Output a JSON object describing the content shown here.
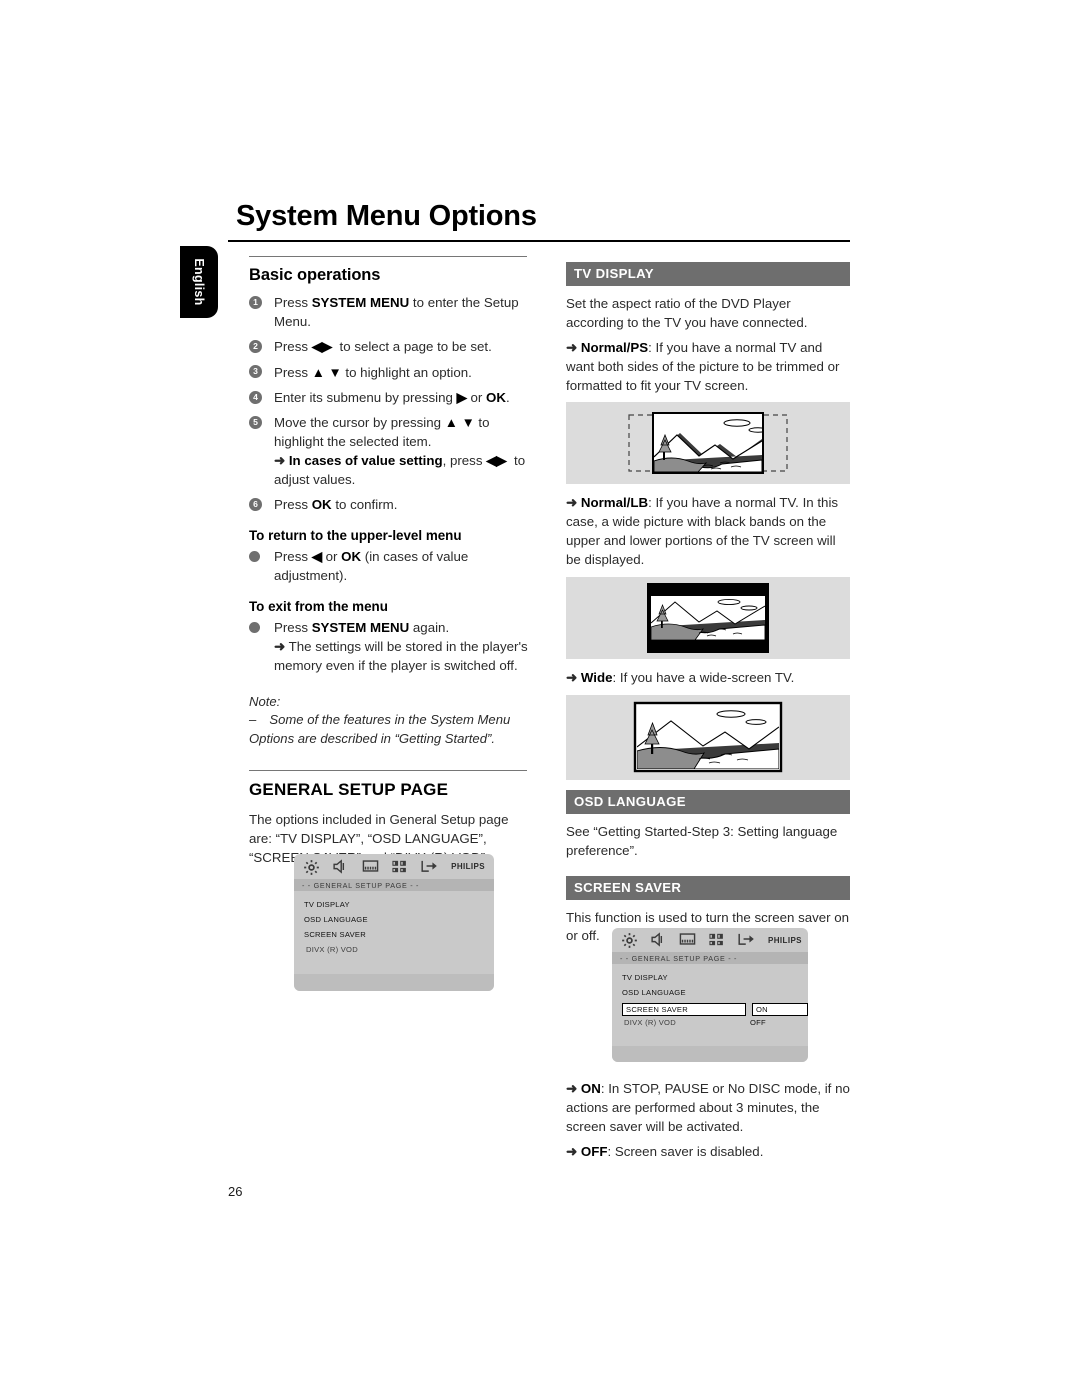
{
  "page": {
    "title": "System Menu Options",
    "language_tab": "English",
    "page_number": "26"
  },
  "left_column": {
    "basic_operations": {
      "heading": "Basic operations",
      "steps": [
        {
          "num": "1",
          "html": "Press <b>SYSTEM MENU</b> to enter the Setup Menu."
        },
        {
          "num": "2",
          "html": "Press <b>◀▶</b>&nbsp; to select a page to be set."
        },
        {
          "num": "3",
          "html": "Press <b>▲ ▼</b> to highlight an option."
        },
        {
          "num": "4",
          "html": "Enter its submenu by pressing <b>▶</b> or <b>OK</b>."
        },
        {
          "num": "5",
          "html": "Move the cursor by pressing <b>▲ ▼</b> to highlight the selected item.<br><span class=\"arrow\">➜</span> <b>In cases of value setting</b>, press <b>◀▶</b>&nbsp; to adjust values."
        },
        {
          "num": "6",
          "html": "Press <b>OK</b> to confirm."
        }
      ],
      "return_heading": "To return to the upper-level menu",
      "return_text": "Press <b>◀</b> or <b>OK</b> (in cases of value adjustment).",
      "exit_heading": "To exit from the menu",
      "exit_text": "Press <b>SYSTEM MENU</b> again.<br><span class=\"arrow\">➜</span> The settings will be stored in the player's memory even if the player is switched off.",
      "note_label": "Note:",
      "note_text": "– Some of the features in the System Menu Options are described in “Getting Started”."
    },
    "general_setup": {
      "heading": "GENERAL SETUP PAGE",
      "intro": "The options included in General Setup page are: “TV DISPLAY”, “OSD LANGUAGE”, “SCREEN SAVER” and  “DIVX (R) VOD”."
    },
    "osd_mockup": {
      "brand": "PHILIPS",
      "title": "- -  GENERAL  SETUP  PAGE  - -",
      "items": [
        "TV DISPLAY",
        "OSD LANGUAGE",
        "SCREEN SAVER",
        "DIVX (R) VOD"
      ],
      "icons": [
        "gear-icon",
        "speaker-icon",
        "video-icon",
        "preference-icon",
        "exit-icon"
      ]
    }
  },
  "right_column": {
    "tv_display": {
      "bar": "TV DISPLAY",
      "intro": "Set the aspect ratio of the DVD Player according to the TV you have connected.",
      "normal_ps": "<span class=\"arrow\">➜</span> <b>Normal/PS</b>: If you have a normal TV and want both sides of the picture to be trimmed or formatted to fit your TV screen.",
      "normal_lb": "<span class=\"arrow\">➜</span> <b>Normal/LB</b>: If you have a normal TV. In this case, a wide picture with black bands on the upper and lower portions of the TV screen will be displayed.",
      "wide": "<span class=\"arrow\">➜</span> <b>Wide</b>: If you have a wide-screen TV."
    },
    "osd_language": {
      "bar": "OSD LANGUAGE",
      "text": "See “Getting Started-Step 3: Setting language preference”."
    },
    "screen_saver": {
      "bar": "SCREEN SAVER",
      "text": "This function is used to turn the screen saver on or off.",
      "on_text": "<span class=\"arrow\">➜</span> <b>ON</b>: In STOP, PAUSE or No DISC mode, if no actions are performed about 3 minutes, the screen saver will be activated.",
      "off_text": "<span class=\"arrow\">➜</span> <b>OFF</b>: Screen saver is disabled."
    },
    "osd_mockup": {
      "brand": "PHILIPS",
      "title": "- -  GENERAL  SETUP  PAGE  - -",
      "items": [
        "TV DISPLAY",
        "OSD LANGUAGE",
        "SCREEN SAVER",
        "DIVX (R) VOD"
      ],
      "highlighted_item": "SCREEN SAVER",
      "option_selected": "ON",
      "option_other": "OFF",
      "icons": [
        "gear-icon",
        "speaker-icon",
        "video-icon",
        "preference-icon",
        "exit-icon"
      ]
    }
  },
  "colors": {
    "header_bar": "#6e6e6e",
    "illustration_bg": "#dcdcdc",
    "osd_bg": "#c9c9c9",
    "bullet": "#6f6f6f"
  }
}
